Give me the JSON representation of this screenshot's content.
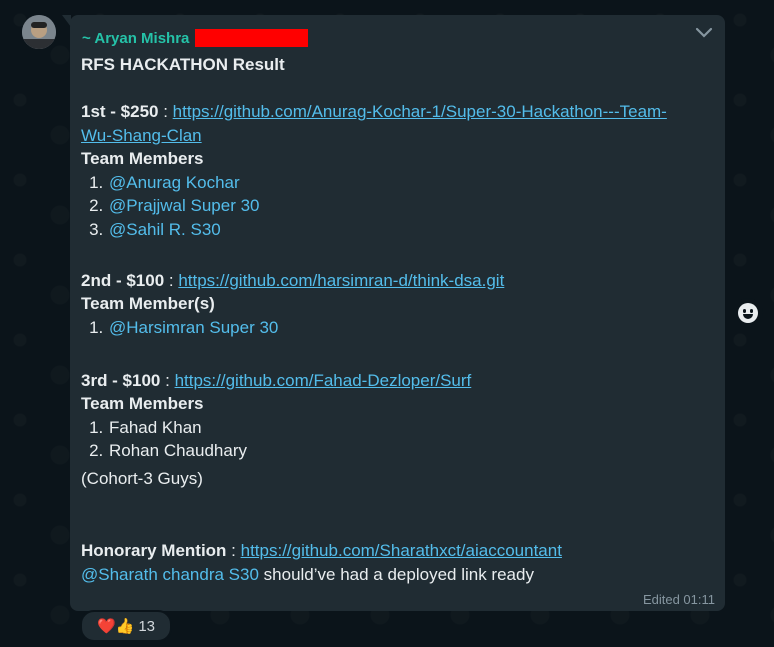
{
  "message": {
    "sender": "~ Aryan Mishra",
    "title": "RFS HACKATHON Result",
    "first": {
      "place": "1st - $250",
      "sep": " : ",
      "link_line1": "https://github.com/Anurag-Kochar-1/Super-30-Hackathon---Team-",
      "link_line2": "Wu-Shang-Clan",
      "members_label": "Team Members",
      "members": [
        "@Anurag Kochar",
        "@Prajjwal Super 30",
        "@Sahil R. S30"
      ]
    },
    "second": {
      "place": "2nd - $100",
      "sep": " : ",
      "link": "https://github.com/harsimran-d/think-dsa.git",
      "members_label": "Team Member(s)",
      "members": [
        "@Harsimran Super 30"
      ]
    },
    "third": {
      "place": "3rd - $100",
      "sep": " : ",
      "link": "https://github.com/Fahad-Dezloper/Surf",
      "members_label": "Team Members",
      "members": [
        "Fahad Khan",
        "Rohan Chaudhary"
      ],
      "note": "(Cohort-3 Guys)"
    },
    "honorary": {
      "label": "Honorary Mention",
      "sep": " : ",
      "link": "https://github.com/Sharathxct/aiaccountant",
      "mention": "@Sharath chandra S30",
      "text": " should’ve had a deployed link ready"
    },
    "meta": "Edited 01:11"
  },
  "reactions": {
    "emojis": "❤️👍",
    "count": "13"
  },
  "icons": {
    "menu": "chevron-down-icon",
    "emoji_button": "emoji-smiley-icon"
  }
}
